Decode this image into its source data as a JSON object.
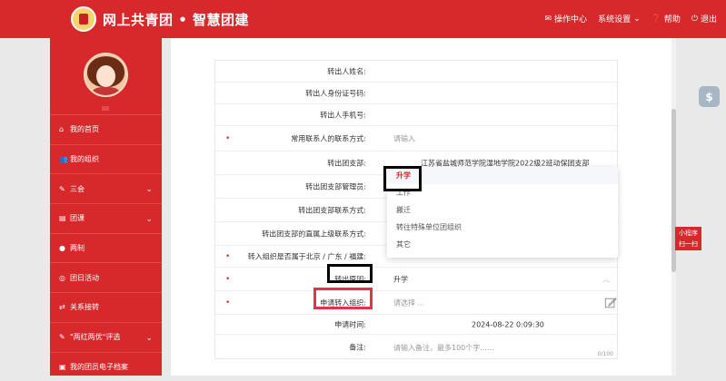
{
  "header": {
    "title": "网上共青团 • 智慧团建",
    "nav": [
      {
        "icon": "mail-icon",
        "label": "操作中心"
      },
      {
        "icon": "",
        "label": "系统设置"
      },
      {
        "icon": "help-icon",
        "label": "帮助"
      },
      {
        "icon": "power-icon",
        "label": "退出"
      }
    ]
  },
  "sidebar": {
    "items": [
      {
        "icon": "home-icon",
        "label": "我的首页",
        "chevron": false
      },
      {
        "icon": "users-icon",
        "label": "我的组织",
        "chevron": false
      },
      {
        "icon": "edit-icon",
        "label": "三会",
        "chevron": true
      },
      {
        "icon": "book-icon",
        "label": "团课",
        "chevron": true
      },
      {
        "icon": "circle-icon",
        "label": "两制",
        "chevron": false
      },
      {
        "icon": "globe-icon",
        "label": "团日活动",
        "chevron": false
      },
      {
        "icon": "transfer-icon",
        "label": "关系接转",
        "chevron": false
      },
      {
        "icon": "edit-icon",
        "label": "\"两红两优\"评选",
        "chevron": true
      },
      {
        "icon": "doc-icon",
        "label": "我的团员电子档案",
        "chevron": false
      }
    ]
  },
  "form": {
    "rows": [
      {
        "label": "转出人姓名:",
        "value": "",
        "required": false
      },
      {
        "label": "转出人身份证号码:",
        "value": "",
        "required": false
      },
      {
        "label": "转出人手机号:",
        "value": "",
        "required": false
      },
      {
        "label": "常用联系人的联系方式:",
        "value": "请输入",
        "required": true
      },
      {
        "label": "转出团支部:",
        "value": "江苏省盐城师范学院湿地学院2022级2班动保团支部",
        "required": false
      },
      {
        "label": "转出团支部管理员:",
        "value": "",
        "required": false
      },
      {
        "label": "转出团支部联系方式:",
        "value": "",
        "required": false
      },
      {
        "label": "转出团支部的直属上级联系方式:",
        "value": "",
        "required": false
      },
      {
        "label": "转入组织是否属于北京 / 广东 / 福建:",
        "value": "",
        "required": true
      },
      {
        "label": "转出原因:",
        "value": "升学",
        "required": true
      },
      {
        "label": "申请转入组织:",
        "value": "请选择 ...",
        "required": true
      },
      {
        "label": "申请时间:",
        "value": "2024-08-22 0:09:30",
        "required": false
      },
      {
        "label": "备注:",
        "value": "请输入备注，最多100个字......",
        "required": false
      }
    ],
    "remark_counter": "0/100"
  },
  "dropdown": {
    "options": [
      "升学",
      "工作",
      "搬迁",
      "转往特殊单位团组织",
      "其它"
    ],
    "selected": "升学"
  },
  "required_mark": "•",
  "floating": {
    "mini_program_line1": "小程序",
    "mini_program_line2": "扫一扫"
  }
}
